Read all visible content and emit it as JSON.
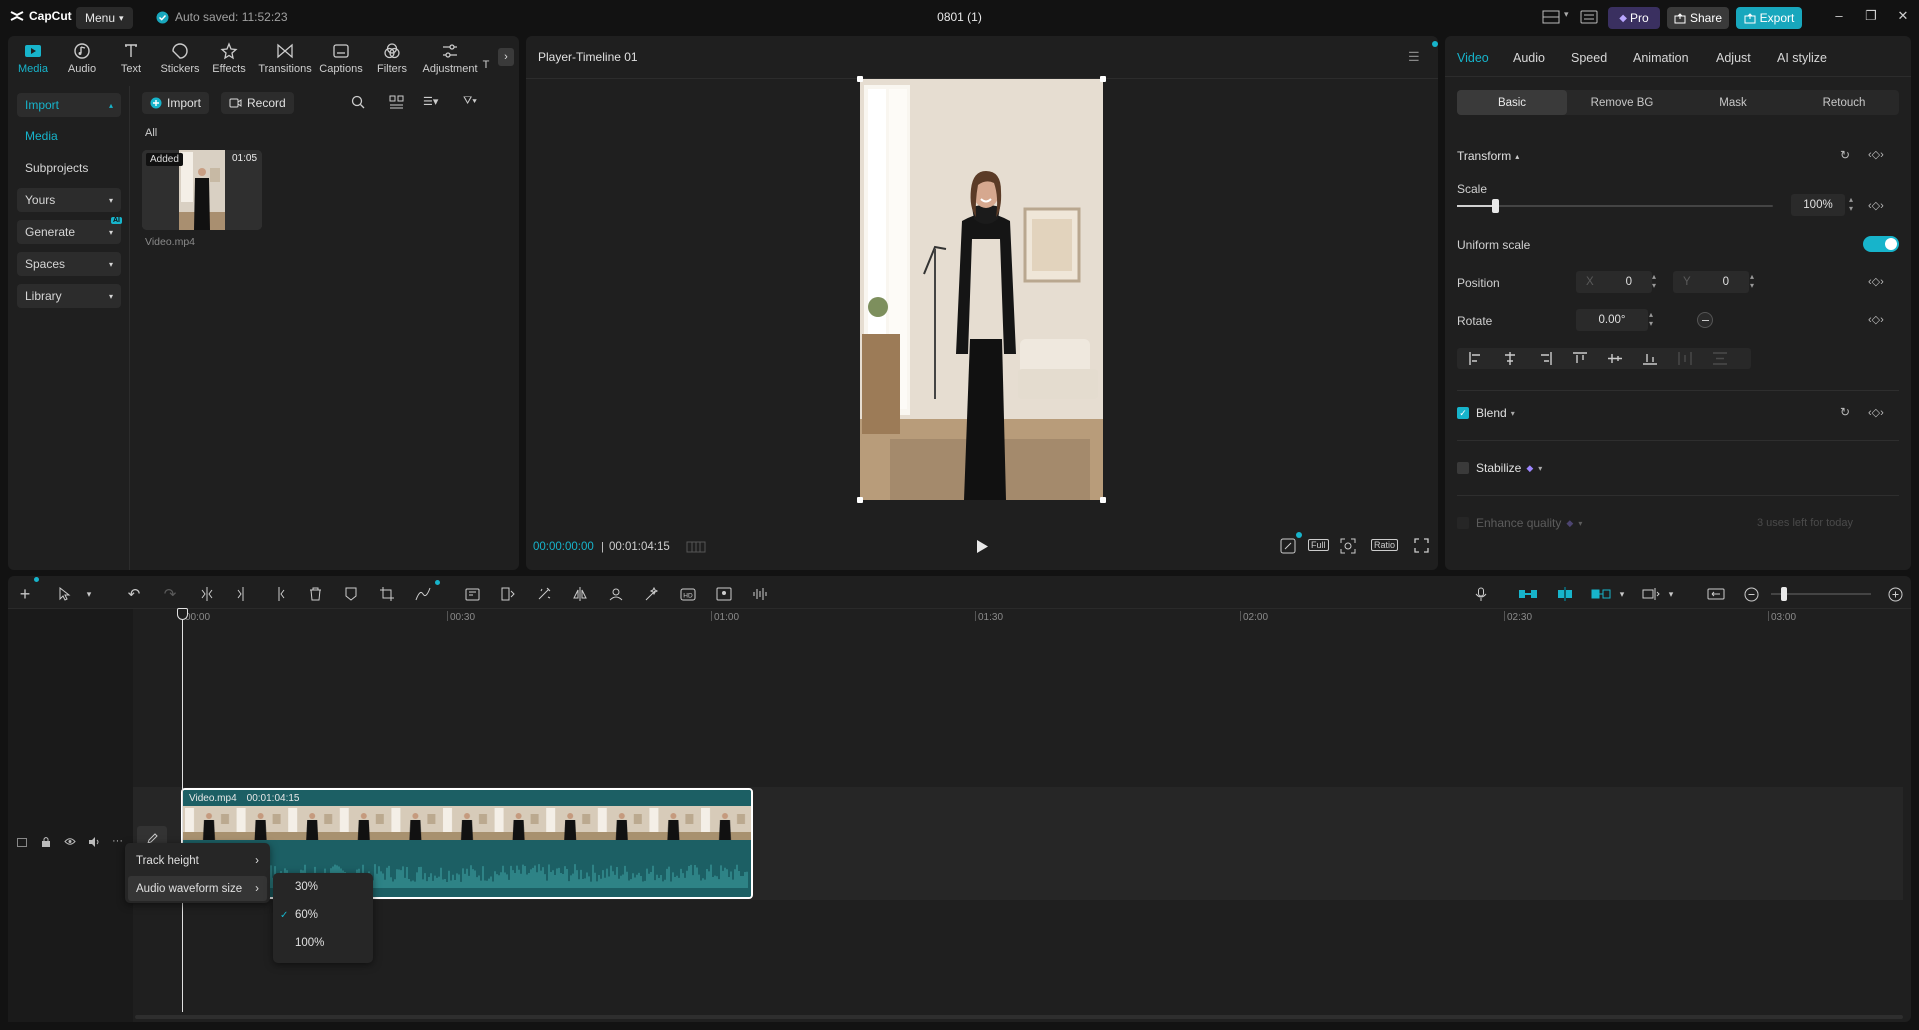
{
  "app": {
    "name": "CapCut",
    "menu_label": "Menu",
    "autosave": "Auto saved: 11:52:23",
    "project_title": "0801 (1)",
    "pro_label": "Pro",
    "share_label": "Share",
    "export_label": "Export",
    "accent": "#18a7bd"
  },
  "tools": [
    {
      "label": "Media",
      "icon": "media-icon"
    },
    {
      "label": "Audio",
      "icon": "audio-icon"
    },
    {
      "label": "Text",
      "icon": "text-icon"
    },
    {
      "label": "Stickers",
      "icon": "stickers-icon"
    },
    {
      "label": "Effects",
      "icon": "effects-icon"
    },
    {
      "label": "Transitions",
      "icon": "transitions-icon"
    },
    {
      "label": "Captions",
      "icon": "captions-icon"
    },
    {
      "label": "Filters",
      "icon": "filters-icon"
    },
    {
      "label": "Adjustment",
      "icon": "adjustment-icon"
    },
    {
      "label": "T",
      "icon": "more-icon"
    }
  ],
  "sidebar": {
    "items": [
      {
        "label": "Import"
      },
      {
        "label": "Media"
      },
      {
        "label": "Subprojects"
      },
      {
        "label": "Yours"
      },
      {
        "label": "Generate",
        "badge": "AI"
      },
      {
        "label": "Spaces"
      },
      {
        "label": "Library"
      }
    ]
  },
  "media": {
    "import_label": "Import",
    "record_label": "Record",
    "filter_label": "All",
    "items": [
      {
        "name": "Video.mp4",
        "tag": "Added",
        "duration": "01:05"
      }
    ]
  },
  "player": {
    "title": "Player-Timeline 01",
    "current_time": "00:00:00:00",
    "total_time": "00:01:04:15",
    "full_label": "Full",
    "ratio_label": "Ratio"
  },
  "inspector": {
    "tabs": [
      "Video",
      "Audio",
      "Speed",
      "Animation",
      "Adjust",
      "AI stylize"
    ],
    "subtabs": [
      "Basic",
      "Remove BG",
      "Mask",
      "Retouch"
    ],
    "transform_label": "Transform",
    "scale_label": "Scale",
    "scale_value": "100%",
    "scale_fraction": 0.12,
    "uniform_scale_label": "Uniform scale",
    "position_label": "Position",
    "pos_x_label": "X",
    "pos_x": "0",
    "pos_y_label": "Y",
    "pos_y": "0",
    "rotate_label": "Rotate",
    "rotate_value": "0.00°",
    "blend_label": "Blend",
    "stabilize_label": "Stabilize",
    "enhance_label": "Enhance quality",
    "enhance_note": "3 uses left for today"
  },
  "timeline": {
    "ruler": [
      "00:00",
      "00:30",
      "01:00",
      "01:30",
      "02:00",
      "02:30",
      "03:00"
    ],
    "clip_name": "Video.mp4",
    "clip_duration": "00:01:04:15",
    "context_menu": [
      {
        "label": "Track height"
      },
      {
        "label": "Audio waveform size"
      }
    ],
    "waveform_options": [
      "30%",
      "60%",
      "100%"
    ],
    "waveform_selected": "60%"
  }
}
